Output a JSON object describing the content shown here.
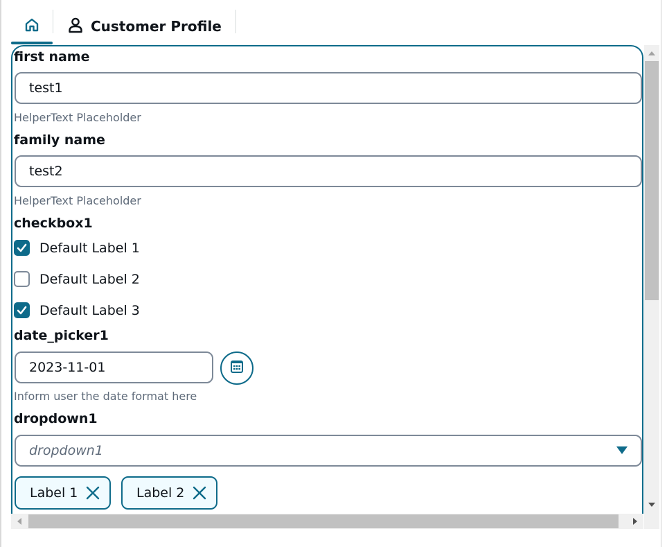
{
  "tabs": {
    "home_icon": "home-icon",
    "profile_icon": "user-icon",
    "profile_label": "Customer Profile"
  },
  "form": {
    "first_name": {
      "label": "first name",
      "value": "test1",
      "helper": "HelperText Placeholder"
    },
    "family_name": {
      "label": "family name",
      "value": "test2",
      "helper": "HelperText Placeholder"
    },
    "checkbox1": {
      "label": "checkbox1",
      "options": [
        {
          "label": "Default Label 1",
          "checked": true
        },
        {
          "label": "Default Label 2",
          "checked": false
        },
        {
          "label": "Default Label 3",
          "checked": true
        }
      ]
    },
    "date_picker1": {
      "label": "date_picker1",
      "value": "2023-11-01",
      "helper": "Inform user the date format here",
      "icon": "calendar-icon"
    },
    "dropdown1": {
      "label": "dropdown1",
      "placeholder": "dropdown1",
      "icon": "caret-down-icon"
    },
    "tokens": [
      {
        "label": "Label 1",
        "icon": "close-icon"
      },
      {
        "label": "Label 2",
        "icon": "close-icon"
      }
    ]
  },
  "colors": {
    "accent": "#0e6b8a",
    "border": "#7d8998",
    "helper_text": "#5f6b7a",
    "token_bg": "#f0fbff"
  }
}
